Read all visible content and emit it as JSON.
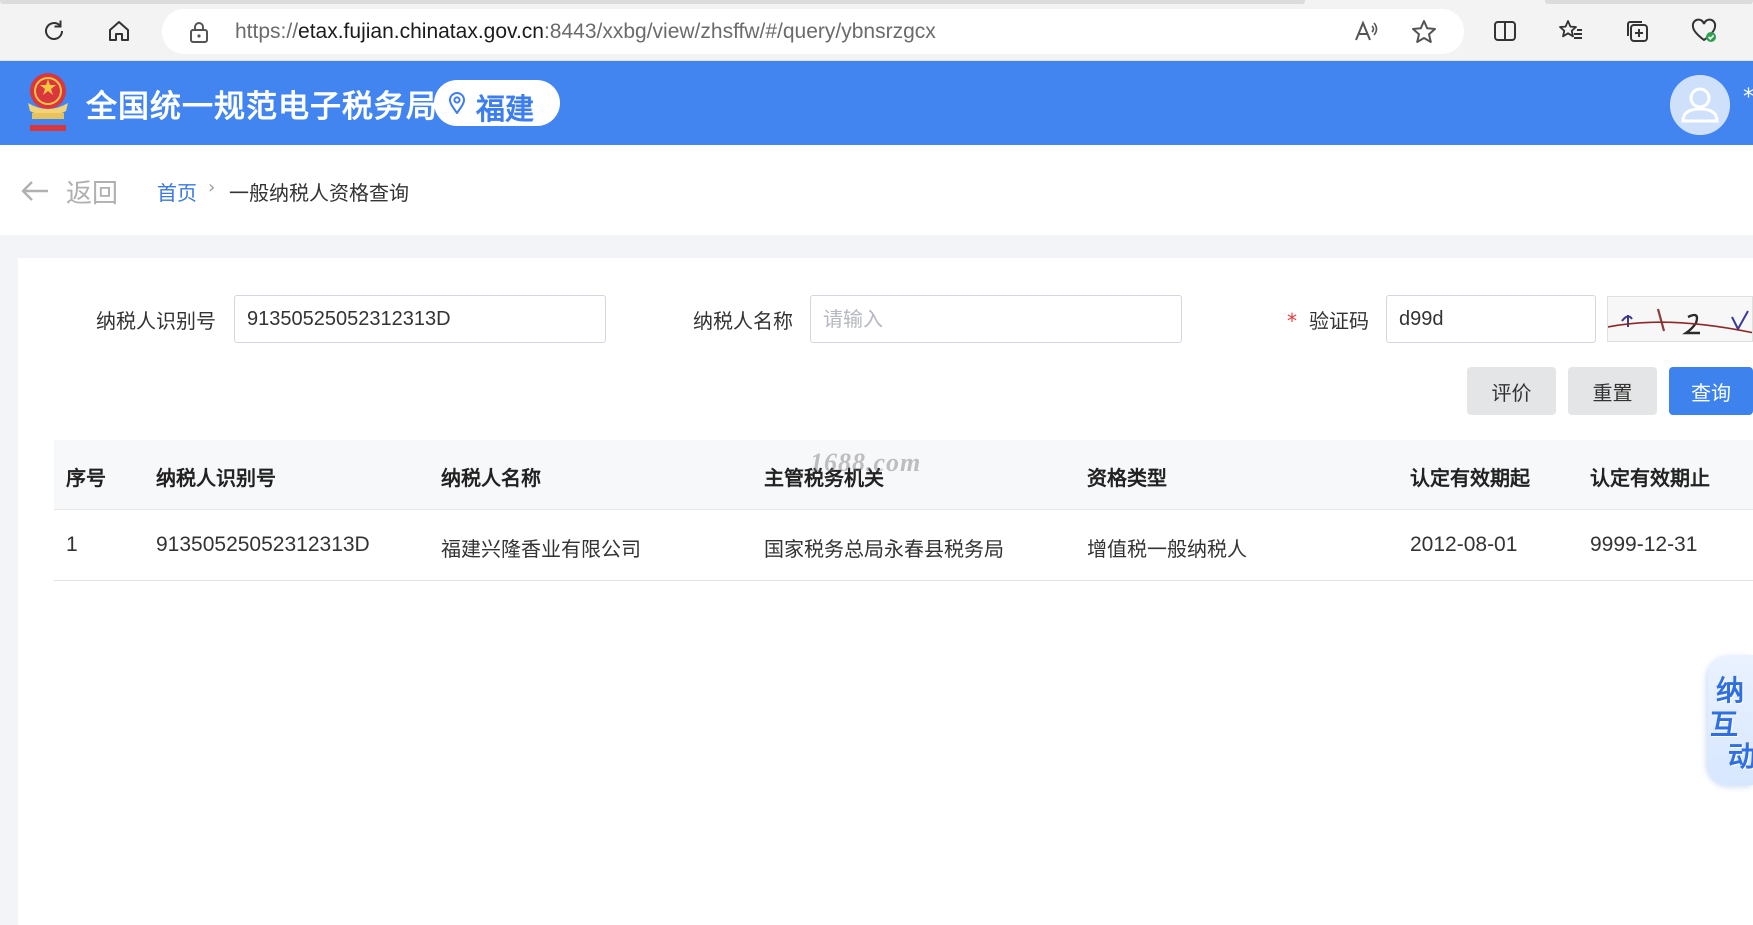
{
  "browser": {
    "url_prefix": "https://",
    "url_host": "etax.fujian.chinatax.gov.cn",
    "url_rest": ":8443/xxbg/view/zhsffw/#/query/ybnsrzgcx"
  },
  "header": {
    "site_title": "全国统一规范电子税务局",
    "region": "福建",
    "extra": "*"
  },
  "breadcrumb": {
    "back_label": "返回",
    "home": "首页",
    "separator": "›",
    "current": "一般纳税人资格查询"
  },
  "form": {
    "taxpayer_id_label": "纳税人识别号",
    "taxpayer_id_value": "91350525052312313D",
    "taxpayer_name_label": "纳税人名称",
    "taxpayer_name_placeholder": "请输入",
    "captcha_required_mark": "*",
    "captcha_label": "验证码",
    "captcha_value": "d99d"
  },
  "buttons": {
    "evaluate": "评价",
    "reset": "重置",
    "query": "查询"
  },
  "table": {
    "columns": [
      "序号",
      "纳税人识别号",
      "纳税人名称",
      "主管税务机关",
      "资格类型",
      "认定有效期起",
      "认定有效期止"
    ],
    "rows": [
      [
        "1",
        "91350525052312313D",
        "福建兴隆香业有限公司",
        "国家税务总局永春县税务局",
        "增值税一般纳税人",
        "2012-08-01",
        "9999-12-31"
      ]
    ]
  },
  "watermark": "1688.com",
  "side_widget": {
    "line1": "纳",
    "line2": "互",
    "line3": "动"
  },
  "colors": {
    "header_blue": "#4285f0",
    "primary_button": "#3d82ed",
    "link_blue": "#3a78e0",
    "required_red": "#e4393c"
  }
}
